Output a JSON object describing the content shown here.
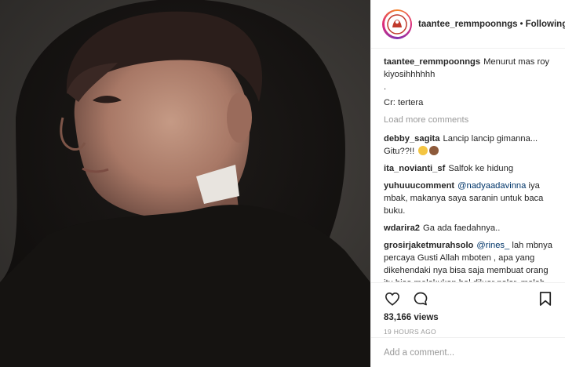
{
  "header": {
    "username": "taantee_remmpoonngs",
    "separator": "•",
    "follow_label": "Following"
  },
  "caption": {
    "username": "taantee_remmpoonngs",
    "line1": "Menurut mas roy kiyosihhhhhh",
    "line2": ".",
    "line3": "Cr: tertera"
  },
  "load_more_label": "Load more comments",
  "comments": [
    {
      "username": "debby_sagita",
      "text": "Lancip lancip gimanna... Gitu??!!",
      "emojis": [
        "confused-face-emoji",
        "see-no-evil-monkey-emoji"
      ]
    },
    {
      "username": "ita_novianti_sf",
      "text": "Salfok ke hidung"
    },
    {
      "username": "yuhuuucomment",
      "mention": "@nadyaadavinna",
      "text": "iya mbak, makanya saya saranin untuk baca buku."
    },
    {
      "username": "wdarira2",
      "text": "Ga ada faedahnya.."
    },
    {
      "username": "grosirjaketmurahsolo",
      "mention": "@rines_",
      "text": "lah mbnya percaya Gusti Allah mboten , apa yang dikehendaki nya bisa saja membuat orang itu bisa melakukan hal diluar nalar. malah seperti TDK percaya Allah SWT kalo segala sesuatu kehendaknya dblg penyakit."
    }
  ],
  "actions": {
    "like_icon": "heart-icon",
    "comment_icon": "comment-bubble-icon",
    "bookmark_icon": "bookmark-icon"
  },
  "views": "83,166 views",
  "timestamp": "19 HOURS AGO",
  "add_comment": {
    "placeholder": "Add a comment..."
  },
  "colors": {
    "border": "#efefef",
    "muted": "#999999",
    "text": "#262626",
    "mention": "#003569"
  }
}
